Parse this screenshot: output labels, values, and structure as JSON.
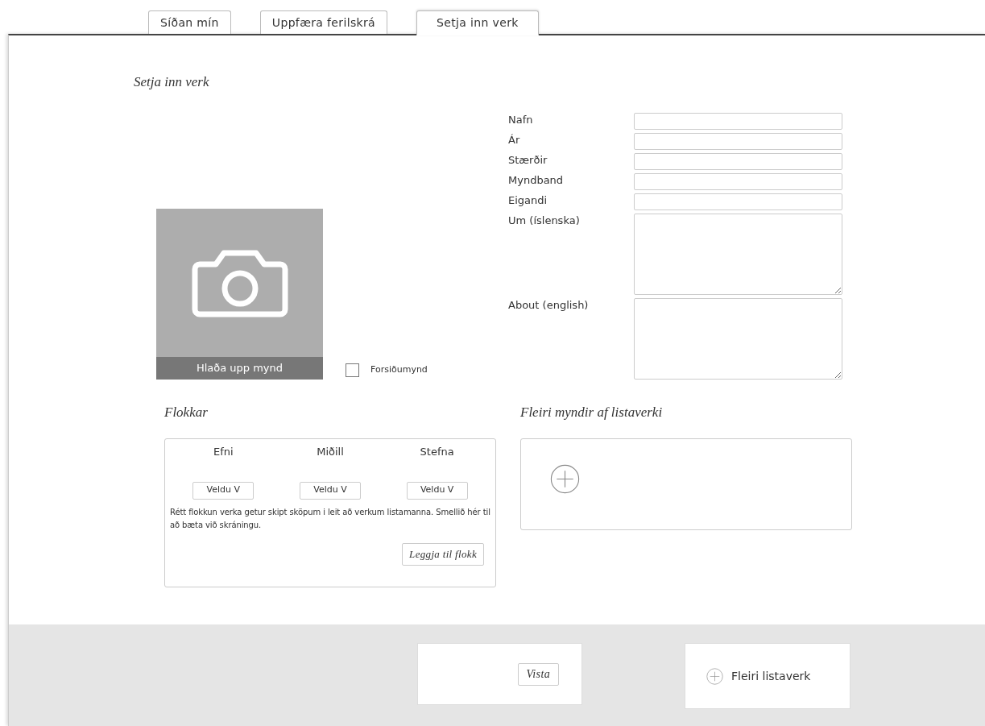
{
  "tabs": [
    {
      "label": "Síðan mín",
      "selected": false
    },
    {
      "label": "Uppfæra ferilskrá",
      "selected": false
    },
    {
      "label": "Setja inn verk",
      "selected": true
    }
  ],
  "heading": "Setja inn verk",
  "upload": {
    "label": "Hlaða upp mynd"
  },
  "cover_checkbox": {
    "label": "Forsiðumynd",
    "checked": false
  },
  "fields": [
    {
      "label": "Nafn",
      "kind": "input"
    },
    {
      "label": "Ár",
      "kind": "input"
    },
    {
      "label": "Stærðir",
      "kind": "input"
    },
    {
      "label": "Myndband",
      "kind": "input"
    },
    {
      "label": "Eigandi",
      "kind": "input"
    },
    {
      "label": "Um (íslenska)",
      "kind": "textarea"
    },
    {
      "label": "About (english)",
      "kind": "textarea"
    }
  ],
  "categories": {
    "heading": "Flokkar",
    "columns": [
      {
        "label": "Efni",
        "select": "Veldu V"
      },
      {
        "label": "Miðill",
        "select": "Veldu V"
      },
      {
        "label": "Stefna",
        "select": "Veldu V"
      }
    ],
    "note": "Rétt flokkun verka getur skipt sköpum i leit að verkum listamanna. Smellið hér til að bæta við skráningu.",
    "suggest_button": "Leggja til flokk"
  },
  "more_images": {
    "heading": "Fleiri myndir af listaverki"
  },
  "footer": {
    "save_button": "Vista",
    "more_works_button": "Fleiri listaverk"
  }
}
